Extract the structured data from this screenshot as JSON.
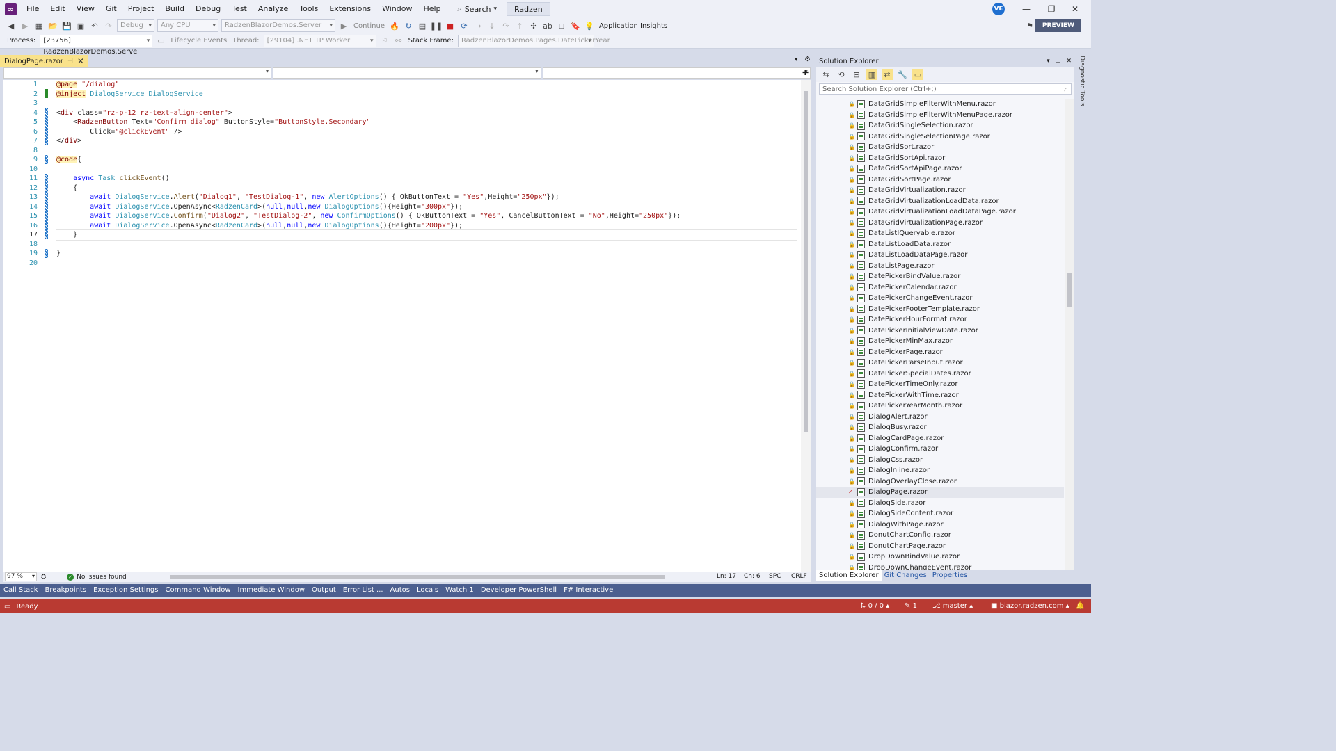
{
  "menu": {
    "items": [
      "File",
      "Edit",
      "View",
      "Git",
      "Project",
      "Build",
      "Debug",
      "Test",
      "Analyze",
      "Tools",
      "Extensions",
      "Window",
      "Help"
    ],
    "search_label": "Search",
    "solution_name": "Radzen",
    "user_initials": "VE"
  },
  "toolbar": {
    "config": "Debug",
    "platform": "Any CPU",
    "startup_project": "RadzenBlazorDemos.Server",
    "continue_label": "Continue",
    "app_insights_label": "Application Insights",
    "preview_label": "PREVIEW"
  },
  "debug_toolbar": {
    "process_label": "Process:",
    "process_value": "[23756] RadzenBlazorDemos.Serve",
    "lifecycle_label": "Lifecycle Events",
    "thread_label": "Thread:",
    "thread_value": "[29104] .NET TP Worker",
    "stack_frame_label": "Stack Frame:",
    "stack_frame_value": "RadzenBlazorDemos.Pages.DatePickerYear"
  },
  "editor": {
    "tab_title": "DialogPage.razor",
    "line_numbers": [
      "1",
      "2",
      "3",
      "4",
      "5",
      "6",
      "7",
      "8",
      "9",
      "10",
      "11",
      "12",
      "13",
      "14",
      "15",
      "16",
      "17",
      "18",
      "19",
      "20"
    ],
    "current_line": 17,
    "lines": [
      "@page \"/dialog\"",
      "@inject DialogService DialogService",
      "",
      "<div class=\"rz-p-12 rz-text-align-center\">",
      "    <RadzenButton Text=\"Confirm dialog\" ButtonStyle=\"ButtonStyle.Secondary\"",
      "        Click=\"@clickEvent\" />",
      "</div>",
      "",
      "@code{",
      "",
      "    async Task clickEvent()",
      "    {",
      "        await DialogService.Alert(\"Dialog1\", \"TestDialog-1\", new AlertOptions() { OkButtonText = \"Yes\",Height=\"250px\"});",
      "        await DialogService.OpenAsync<RadzenCard>(null,null,new DialogOptions(){Height=\"300px\"});",
      "        await DialogService.Confirm(\"Dialog2\", \"TestDialog-2\", new ConfirmOptions() { OkButtonText = \"Yes\", CancelButtonText = \"No\",Height=\"250px\"});",
      "        await DialogService.OpenAsync<RadzenCard>(null,null,new DialogOptions(){Height=\"200px\"});",
      "    }",
      "",
      "}",
      ""
    ],
    "zoom": "97 %",
    "issues": "No issues found",
    "ln": "Ln: 17",
    "ch": "Ch: 6",
    "spc": "SPC",
    "eol": "CRLF"
  },
  "solution_explorer": {
    "title": "Solution Explorer",
    "search_placeholder": "Search Solution Explorer (Ctrl+;)",
    "files": [
      "DataGridSimpleFilterWithMenu.razor",
      "DataGridSimpleFilterWithMenuPage.razor",
      "DataGridSingleSelection.razor",
      "DataGridSingleSelectionPage.razor",
      "DataGridSort.razor",
      "DataGridSortApi.razor",
      "DataGridSortApiPage.razor",
      "DataGridSortPage.razor",
      "DataGridVirtualization.razor",
      "DataGridVirtualizationLoadData.razor",
      "DataGridVirtualizationLoadDataPage.razor",
      "DataGridVirtualizationPage.razor",
      "DataListIQueryable.razor",
      "DataListLoadData.razor",
      "DataListLoadDataPage.razor",
      "DataListPage.razor",
      "DatePickerBindValue.razor",
      "DatePickerCalendar.razor",
      "DatePickerChangeEvent.razor",
      "DatePickerFooterTemplate.razor",
      "DatePickerHourFormat.razor",
      "DatePickerInitialViewDate.razor",
      "DatePickerMinMax.razor",
      "DatePickerPage.razor",
      "DatePickerParseInput.razor",
      "DatePickerSpecialDates.razor",
      "DatePickerTimeOnly.razor",
      "DatePickerWithTime.razor",
      "DatePickerYearMonth.razor",
      "DialogAlert.razor",
      "DialogBusy.razor",
      "DialogCardPage.razor",
      "DialogConfirm.razor",
      "DialogCss.razor",
      "DialogInline.razor",
      "DialogOverlayClose.razor",
      "DialogPage.razor",
      "DialogSide.razor",
      "DialogSideContent.razor",
      "DialogWithPage.razor",
      "DonutChartConfig.razor",
      "DonutChartPage.razor",
      "DropDownBindValue.razor",
      "DropDownChangeEvent.razor"
    ],
    "selected_file": "DialogPage.razor",
    "tabs": [
      "Solution Explorer",
      "Git Changes",
      "Properties"
    ]
  },
  "side_tab": "Diagnostic Tools",
  "bottom_tabs": [
    "Call Stack",
    "Breakpoints",
    "Exception Settings",
    "Command Window",
    "Immediate Window",
    "Output",
    "Error List ...",
    "Autos",
    "Locals",
    "Watch 1",
    "Developer PowerShell",
    "F# Interactive"
  ],
  "status": {
    "ready": "Ready",
    "sync": "0 / 0",
    "edits": "1",
    "branch": "master",
    "repo": "blazor.radzen.com"
  },
  "colors": {
    "status_bar": "#b93a32",
    "tool_tabs": "#4c5f8f",
    "doc_tab": "#f9e28b"
  }
}
